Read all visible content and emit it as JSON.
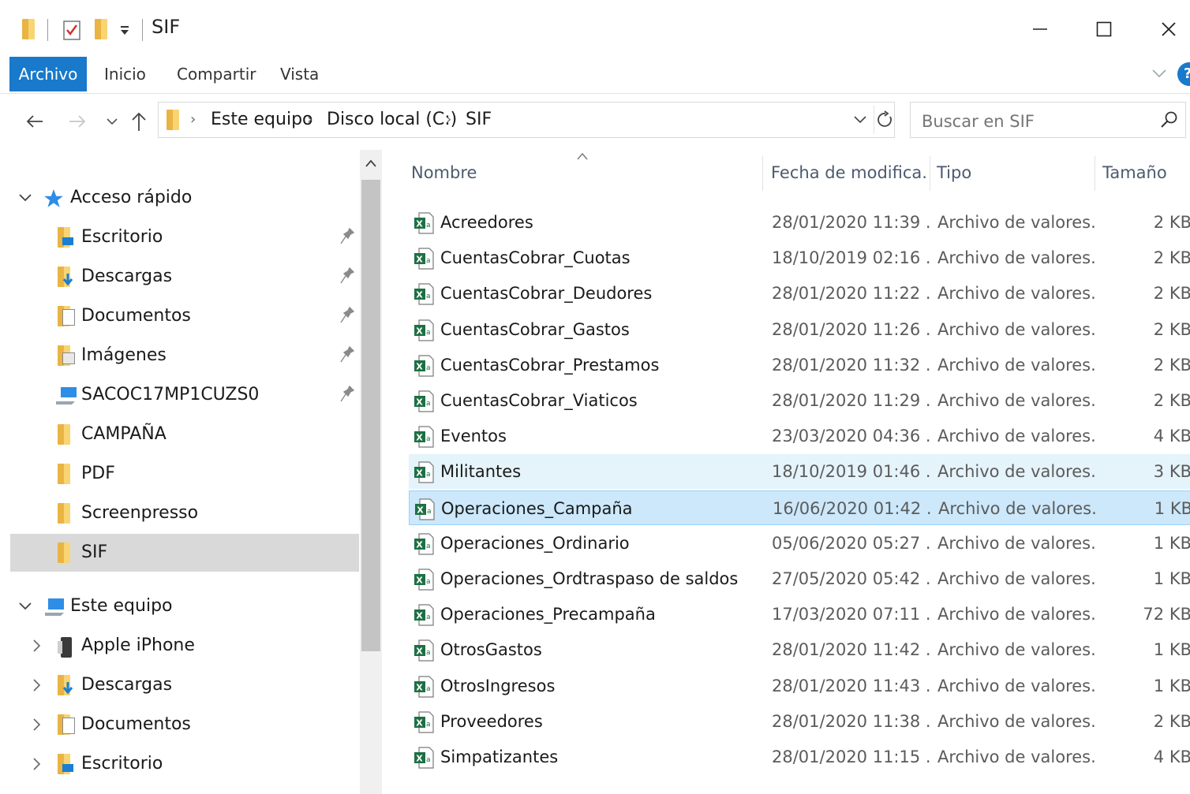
{
  "window": {
    "title": "SIF",
    "minimize_label": "—",
    "maximize_label": "☐",
    "close_label": "✕"
  },
  "ribbon": {
    "tabs": [
      "Archivo",
      "Inicio",
      "Compartir",
      "Vista"
    ]
  },
  "address": {
    "crumbs": [
      "Este equipo",
      "Disco local (C:)",
      "SIF"
    ]
  },
  "search": {
    "placeholder": "Buscar en SIF"
  },
  "sidebar": {
    "quick_access": {
      "label": "Acceso rápido",
      "items": [
        {
          "label": "Escritorio",
          "icon": "desktop-folder-icon",
          "pinned": true
        },
        {
          "label": "Descargas",
          "icon": "downloads-folder-icon",
          "pinned": true
        },
        {
          "label": "Documentos",
          "icon": "documents-folder-icon",
          "pinned": true
        },
        {
          "label": "Imágenes",
          "icon": "pictures-folder-icon",
          "pinned": true
        },
        {
          "label": "SACOC17MP1CUZS0",
          "icon": "network-computer-icon",
          "pinned": true
        },
        {
          "label": "CAMPAÑA",
          "icon": "folder-icon",
          "pinned": false
        },
        {
          "label": "PDF",
          "icon": "folder-icon",
          "pinned": false
        },
        {
          "label": "Screenpresso",
          "icon": "folder-icon",
          "pinned": false
        },
        {
          "label": "SIF",
          "icon": "folder-icon",
          "pinned": false,
          "selected": true
        }
      ]
    },
    "this_pc": {
      "label": "Este equipo",
      "items": [
        {
          "label": "Apple iPhone",
          "icon": "phone-icon"
        },
        {
          "label": "Descargas",
          "icon": "downloads-folder-icon"
        },
        {
          "label": "Documentos",
          "icon": "documents-folder-icon"
        },
        {
          "label": "Escritorio",
          "icon": "desktop-folder-icon"
        }
      ]
    }
  },
  "file_list": {
    "columns": [
      "Nombre",
      "Fecha de modifica...",
      "Tipo",
      "Tamaño"
    ],
    "rows": [
      {
        "name": "Acreedores",
        "date": "28/01/2020 11:39 ...",
        "type": "Archivo de valores...",
        "size": "2 KB"
      },
      {
        "name": "CuentasCobrar_Cuotas",
        "date": "18/10/2019 02:16 ...",
        "type": "Archivo de valores...",
        "size": "2 KB"
      },
      {
        "name": "CuentasCobrar_Deudores",
        "date": "28/01/2020 11:22 ...",
        "type": "Archivo de valores...",
        "size": "2 KB"
      },
      {
        "name": "CuentasCobrar_Gastos",
        "date": "28/01/2020 11:26 ...",
        "type": "Archivo de valores...",
        "size": "2 KB"
      },
      {
        "name": "CuentasCobrar_Prestamos",
        "date": "28/01/2020 11:32 ...",
        "type": "Archivo de valores...",
        "size": "2 KB"
      },
      {
        "name": "CuentasCobrar_Viaticos",
        "date": "28/01/2020 11:29 ...",
        "type": "Archivo de valores...",
        "size": "2 KB"
      },
      {
        "name": "Eventos",
        "date": "23/03/2020 04:36 ...",
        "type": "Archivo de valores...",
        "size": "4 KB"
      },
      {
        "name": "Militantes",
        "date": "18/10/2019 01:46 ...",
        "type": "Archivo de valores...",
        "size": "3 KB",
        "state": "hover"
      },
      {
        "name": "Operaciones_Campaña",
        "date": "16/06/2020 01:42 ...",
        "type": "Archivo de valores...",
        "size": "1 KB",
        "state": "selected"
      },
      {
        "name": "Operaciones_Ordinario",
        "date": "05/06/2020 05:27 ...",
        "type": "Archivo de valores...",
        "size": "1 KB"
      },
      {
        "name": "Operaciones_Ordtraspaso de saldos",
        "date": "27/05/2020 05:42 ...",
        "type": "Archivo de valores...",
        "size": "1 KB"
      },
      {
        "name": "Operaciones_Precampaña",
        "date": "17/03/2020 07:11 ...",
        "type": "Archivo de valores...",
        "size": "72 KB"
      },
      {
        "name": "OtrosGastos",
        "date": "28/01/2020 11:42 ...",
        "type": "Archivo de valores...",
        "size": "1 KB"
      },
      {
        "name": "OtrosIngresos",
        "date": "28/01/2020 11:43 ...",
        "type": "Archivo de valores...",
        "size": "1 KB"
      },
      {
        "name": "Proveedores",
        "date": "28/01/2020 11:38 ...",
        "type": "Archivo de valores...",
        "size": "2 KB"
      },
      {
        "name": "Simpatizantes",
        "date": "28/01/2020 11:15 ...",
        "type": "Archivo de valores...",
        "size": "4 KB"
      }
    ]
  },
  "colors": {
    "accent": "#1979ca",
    "selected_row": "#cce8fa",
    "hover_row": "#e5f3fb",
    "excel_green": "#1d7044"
  }
}
